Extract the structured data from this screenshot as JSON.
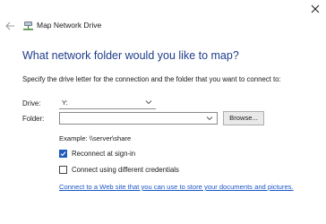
{
  "window": {
    "title": "Map Network Drive",
    "close_icon": "close-icon",
    "back_icon": "back-arrow-icon",
    "app_icon": "network-drive-icon"
  },
  "heading": "What network folder would you like to map?",
  "instruction": "Specify the drive letter for the connection and the folder that you want to connect to:",
  "drive": {
    "label": "Drive:",
    "value": "Y:"
  },
  "folder": {
    "label": "Folder:",
    "value": "",
    "browse_label": "Browse..."
  },
  "example": "Example: \\\\server\\share",
  "reconnect": {
    "label": "Reconnect at sign-in",
    "checked": true
  },
  "credentials": {
    "label": "Connect using different credentials",
    "checked": false
  },
  "link": "Connect to a Web site that you can use to store your documents and pictures.",
  "colors": {
    "accent": "#1f5dbd",
    "heading": "#1f3d8a",
    "link": "#1a56c8"
  }
}
